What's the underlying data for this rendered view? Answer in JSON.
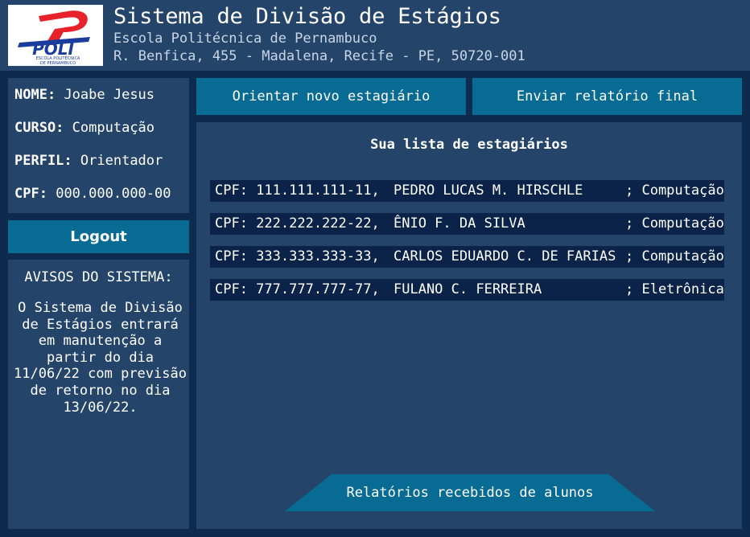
{
  "header": {
    "title": "Sistema de Divisão de Estágios",
    "subtitle": "Escola Politécnica de Pernambuco",
    "address": "R. Benfica, 455 - Madalena, Recife - PE, 50720-001",
    "logo_text": "POLI",
    "logo_caption_1": "ESCOLA POLITÉCNICA",
    "logo_caption_2": "DE PERNAMBUCO"
  },
  "user": {
    "name_label": "NOME:",
    "name": "Joabe Jesus",
    "course_label": "CURSO:",
    "course": "Computação",
    "profile_label": "PERFIL:",
    "profile": "Orientador",
    "cpf_label": "CPF:",
    "cpf": "000.000.000-00"
  },
  "logout_label": "Logout",
  "notices": {
    "title": "AVISOS DO SISTEMA:",
    "text": "O Sistema de Divisão de Estágios entrará em manutenção a partir do dia 11/06/22 com previsão de retorno no dia 13/06/22."
  },
  "actions": {
    "orient_label": "Orientar novo estagiário",
    "report_label": "Enviar relatório final"
  },
  "interns": {
    "title": "Sua lista de estagiários",
    "rows": [
      {
        "cpf": "CPF: 111.111.111-11,",
        "name": "PEDRO LUCAS M. HIRSCHLE",
        "course": "; Computação"
      },
      {
        "cpf": "CPF: 222.222.222-22,",
        "name": "ÊNIO F. DA SILVA",
        "course": "; Computação"
      },
      {
        "cpf": "CPF: 333.333.333-33,",
        "name": "CARLOS EDUARDO C. DE FARIAS",
        "course": "; Computação"
      },
      {
        "cpf": "CPF: 777.777.777-77,",
        "name": "FULANO C. FERREIRA",
        "course": "; Eletrônica"
      }
    ]
  },
  "reports_label": "Relatórios recebidos de alunos",
  "colors": {
    "background": "#0e2a4f",
    "panel": "#254469",
    "accent": "#086b94",
    "row": "#0b2348",
    "logo_red": "#e8222a",
    "logo_blue": "#1a3d9c"
  }
}
